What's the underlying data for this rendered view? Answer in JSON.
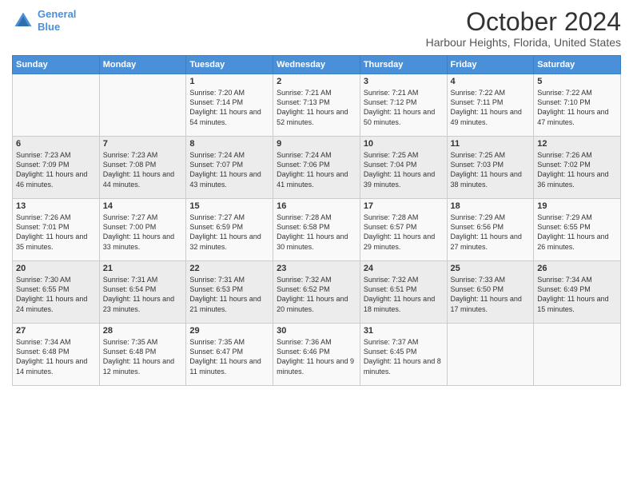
{
  "header": {
    "logo_line1": "General",
    "logo_line2": "Blue",
    "title": "October 2024",
    "subtitle": "Harbour Heights, Florida, United States"
  },
  "columns": [
    "Sunday",
    "Monday",
    "Tuesday",
    "Wednesday",
    "Thursday",
    "Friday",
    "Saturday"
  ],
  "weeks": [
    [
      {
        "day": "",
        "sunrise": "",
        "sunset": "",
        "daylight": ""
      },
      {
        "day": "",
        "sunrise": "",
        "sunset": "",
        "daylight": ""
      },
      {
        "day": "1",
        "sunrise": "Sunrise: 7:20 AM",
        "sunset": "Sunset: 7:14 PM",
        "daylight": "Daylight: 11 hours and 54 minutes."
      },
      {
        "day": "2",
        "sunrise": "Sunrise: 7:21 AM",
        "sunset": "Sunset: 7:13 PM",
        "daylight": "Daylight: 11 hours and 52 minutes."
      },
      {
        "day": "3",
        "sunrise": "Sunrise: 7:21 AM",
        "sunset": "Sunset: 7:12 PM",
        "daylight": "Daylight: 11 hours and 50 minutes."
      },
      {
        "day": "4",
        "sunrise": "Sunrise: 7:22 AM",
        "sunset": "Sunset: 7:11 PM",
        "daylight": "Daylight: 11 hours and 49 minutes."
      },
      {
        "day": "5",
        "sunrise": "Sunrise: 7:22 AM",
        "sunset": "Sunset: 7:10 PM",
        "daylight": "Daylight: 11 hours and 47 minutes."
      }
    ],
    [
      {
        "day": "6",
        "sunrise": "Sunrise: 7:23 AM",
        "sunset": "Sunset: 7:09 PM",
        "daylight": "Daylight: 11 hours and 46 minutes."
      },
      {
        "day": "7",
        "sunrise": "Sunrise: 7:23 AM",
        "sunset": "Sunset: 7:08 PM",
        "daylight": "Daylight: 11 hours and 44 minutes."
      },
      {
        "day": "8",
        "sunrise": "Sunrise: 7:24 AM",
        "sunset": "Sunset: 7:07 PM",
        "daylight": "Daylight: 11 hours and 43 minutes."
      },
      {
        "day": "9",
        "sunrise": "Sunrise: 7:24 AM",
        "sunset": "Sunset: 7:06 PM",
        "daylight": "Daylight: 11 hours and 41 minutes."
      },
      {
        "day": "10",
        "sunrise": "Sunrise: 7:25 AM",
        "sunset": "Sunset: 7:04 PM",
        "daylight": "Daylight: 11 hours and 39 minutes."
      },
      {
        "day": "11",
        "sunrise": "Sunrise: 7:25 AM",
        "sunset": "Sunset: 7:03 PM",
        "daylight": "Daylight: 11 hours and 38 minutes."
      },
      {
        "day": "12",
        "sunrise": "Sunrise: 7:26 AM",
        "sunset": "Sunset: 7:02 PM",
        "daylight": "Daylight: 11 hours and 36 minutes."
      }
    ],
    [
      {
        "day": "13",
        "sunrise": "Sunrise: 7:26 AM",
        "sunset": "Sunset: 7:01 PM",
        "daylight": "Daylight: 11 hours and 35 minutes."
      },
      {
        "day": "14",
        "sunrise": "Sunrise: 7:27 AM",
        "sunset": "Sunset: 7:00 PM",
        "daylight": "Daylight: 11 hours and 33 minutes."
      },
      {
        "day": "15",
        "sunrise": "Sunrise: 7:27 AM",
        "sunset": "Sunset: 6:59 PM",
        "daylight": "Daylight: 11 hours and 32 minutes."
      },
      {
        "day": "16",
        "sunrise": "Sunrise: 7:28 AM",
        "sunset": "Sunset: 6:58 PM",
        "daylight": "Daylight: 11 hours and 30 minutes."
      },
      {
        "day": "17",
        "sunrise": "Sunrise: 7:28 AM",
        "sunset": "Sunset: 6:57 PM",
        "daylight": "Daylight: 11 hours and 29 minutes."
      },
      {
        "day": "18",
        "sunrise": "Sunrise: 7:29 AM",
        "sunset": "Sunset: 6:56 PM",
        "daylight": "Daylight: 11 hours and 27 minutes."
      },
      {
        "day": "19",
        "sunrise": "Sunrise: 7:29 AM",
        "sunset": "Sunset: 6:55 PM",
        "daylight": "Daylight: 11 hours and 26 minutes."
      }
    ],
    [
      {
        "day": "20",
        "sunrise": "Sunrise: 7:30 AM",
        "sunset": "Sunset: 6:55 PM",
        "daylight": "Daylight: 11 hours and 24 minutes."
      },
      {
        "day": "21",
        "sunrise": "Sunrise: 7:31 AM",
        "sunset": "Sunset: 6:54 PM",
        "daylight": "Daylight: 11 hours and 23 minutes."
      },
      {
        "day": "22",
        "sunrise": "Sunrise: 7:31 AM",
        "sunset": "Sunset: 6:53 PM",
        "daylight": "Daylight: 11 hours and 21 minutes."
      },
      {
        "day": "23",
        "sunrise": "Sunrise: 7:32 AM",
        "sunset": "Sunset: 6:52 PM",
        "daylight": "Daylight: 11 hours and 20 minutes."
      },
      {
        "day": "24",
        "sunrise": "Sunrise: 7:32 AM",
        "sunset": "Sunset: 6:51 PM",
        "daylight": "Daylight: 11 hours and 18 minutes."
      },
      {
        "day": "25",
        "sunrise": "Sunrise: 7:33 AM",
        "sunset": "Sunset: 6:50 PM",
        "daylight": "Daylight: 11 hours and 17 minutes."
      },
      {
        "day": "26",
        "sunrise": "Sunrise: 7:34 AM",
        "sunset": "Sunset: 6:49 PM",
        "daylight": "Daylight: 11 hours and 15 minutes."
      }
    ],
    [
      {
        "day": "27",
        "sunrise": "Sunrise: 7:34 AM",
        "sunset": "Sunset: 6:48 PM",
        "daylight": "Daylight: 11 hours and 14 minutes."
      },
      {
        "day": "28",
        "sunrise": "Sunrise: 7:35 AM",
        "sunset": "Sunset: 6:48 PM",
        "daylight": "Daylight: 11 hours and 12 minutes."
      },
      {
        "day": "29",
        "sunrise": "Sunrise: 7:35 AM",
        "sunset": "Sunset: 6:47 PM",
        "daylight": "Daylight: 11 hours and 11 minutes."
      },
      {
        "day": "30",
        "sunrise": "Sunrise: 7:36 AM",
        "sunset": "Sunset: 6:46 PM",
        "daylight": "Daylight: 11 hours and 9 minutes."
      },
      {
        "day": "31",
        "sunrise": "Sunrise: 7:37 AM",
        "sunset": "Sunset: 6:45 PM",
        "daylight": "Daylight: 11 hours and 8 minutes."
      },
      {
        "day": "",
        "sunrise": "",
        "sunset": "",
        "daylight": ""
      },
      {
        "day": "",
        "sunrise": "",
        "sunset": "",
        "daylight": ""
      }
    ]
  ]
}
